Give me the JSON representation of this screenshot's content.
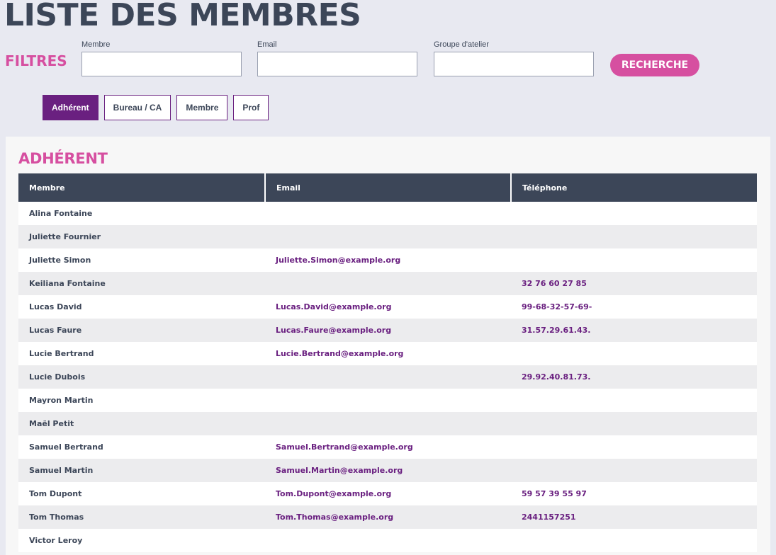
{
  "page_title": "LISTE DES MEMBRES",
  "filters": {
    "label": "FILTRES",
    "member_label": "Membre",
    "email_label": "Email",
    "group_label": "Groupe d'atelier",
    "member_value": "",
    "email_value": "",
    "group_value": "",
    "search_label": "RECHERCHE",
    "search_color": "#d64fa0"
  },
  "roles": [
    {
      "label": "Adhérent",
      "active": true
    },
    {
      "label": "Bureau / CA",
      "active": false
    },
    {
      "label": "Membre",
      "active": false
    },
    {
      "label": "Prof",
      "active": false
    }
  ],
  "section_title": "ADHÉRENT",
  "table": {
    "headers": [
      "Membre",
      "Email",
      "Téléphone"
    ],
    "rows": [
      {
        "name": "Alina Fontaine",
        "email": "",
        "phone": ""
      },
      {
        "name": "Juliette Fournier",
        "email": "",
        "phone": ""
      },
      {
        "name": "Juliette Simon",
        "email": "Juliette.Simon@example.org",
        "phone": ""
      },
      {
        "name": "Keiliana Fontaine",
        "email": "",
        "phone": "32 76 60 27 85"
      },
      {
        "name": "Lucas David",
        "email": "Lucas.David@example.org",
        "phone": "99-68-32-57-69-"
      },
      {
        "name": "Lucas Faure",
        "email": "Lucas.Faure@example.org",
        "phone": "31.57.29.61.43."
      },
      {
        "name": "Lucie Bertrand",
        "email": "Lucie.Bertrand@example.org",
        "phone": ""
      },
      {
        "name": "Lucie Dubois",
        "email": "",
        "phone": "29.92.40.81.73."
      },
      {
        "name": "Mayron Martin",
        "email": "",
        "phone": ""
      },
      {
        "name": "Maël Petit",
        "email": "",
        "phone": ""
      },
      {
        "name": "Samuel Bertrand",
        "email": "Samuel.Bertrand@example.org",
        "phone": ""
      },
      {
        "name": "Samuel Martin",
        "email": "Samuel.Martin@example.org",
        "phone": ""
      },
      {
        "name": "Tom Dupont",
        "email": "Tom.Dupont@example.org",
        "phone": "59 57 39 55 97"
      },
      {
        "name": "Tom Thomas",
        "email": "Tom.Thomas@example.org",
        "phone": "2441157251"
      },
      {
        "name": "Victor Leroy",
        "email": "",
        "phone": ""
      }
    ]
  },
  "colors": {
    "title": "#3c4658",
    "accent_pink": "#d64fa0",
    "accent_purple": "#6a2080",
    "header_bg": "#3c4658",
    "page_bg": "#e8e9f1"
  }
}
